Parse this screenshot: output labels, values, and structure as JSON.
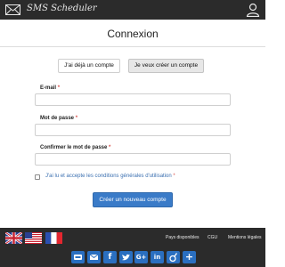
{
  "header": {
    "brand": "SMS Scheduler"
  },
  "page": {
    "title": "Connexion"
  },
  "tabs": {
    "login": "J'ai déjà un compte",
    "register": "Je veux créer un compte"
  },
  "form": {
    "email_label": "E-mail",
    "password_label": "Mot de passe",
    "confirm_label": "Confirmer le mot de passe",
    "required_mark": "*",
    "email_value": "",
    "password_value": "",
    "confirm_value": "",
    "terms_label": "J'ai lu et accepte les conditions générales d'utilisation",
    "terms_checked": false,
    "submit_label": "Créer un nouveau compte"
  },
  "footer": {
    "links": [
      "Pays disponibles",
      "CGU",
      "Mentions légales"
    ],
    "flags": [
      "flag-uk-icon",
      "flag-us-icon",
      "flag-fr-icon"
    ],
    "social": [
      {
        "icon": "share-icon",
        "glyph": "⎘",
        "color": "#2a6fc0"
      },
      {
        "icon": "email-icon",
        "glyph": "✉",
        "color": "#2a6fc0"
      },
      {
        "icon": "facebook-icon",
        "glyph": "f",
        "color": "#2a6fc0"
      },
      {
        "icon": "twitter-icon",
        "glyph": "t",
        "color": "#2a6fc0"
      },
      {
        "icon": "google-plus-icon",
        "glyph": "G+",
        "color": "#2a6fc0"
      },
      {
        "icon": "linkedin-icon",
        "glyph": "in",
        "color": "#2a6fc0"
      },
      {
        "icon": "viadeo-icon",
        "glyph": "ʋ",
        "color": "#2a6fc0"
      },
      {
        "icon": "more-share-icon",
        "glyph": "+",
        "color": "#2a6fc0"
      }
    ]
  }
}
